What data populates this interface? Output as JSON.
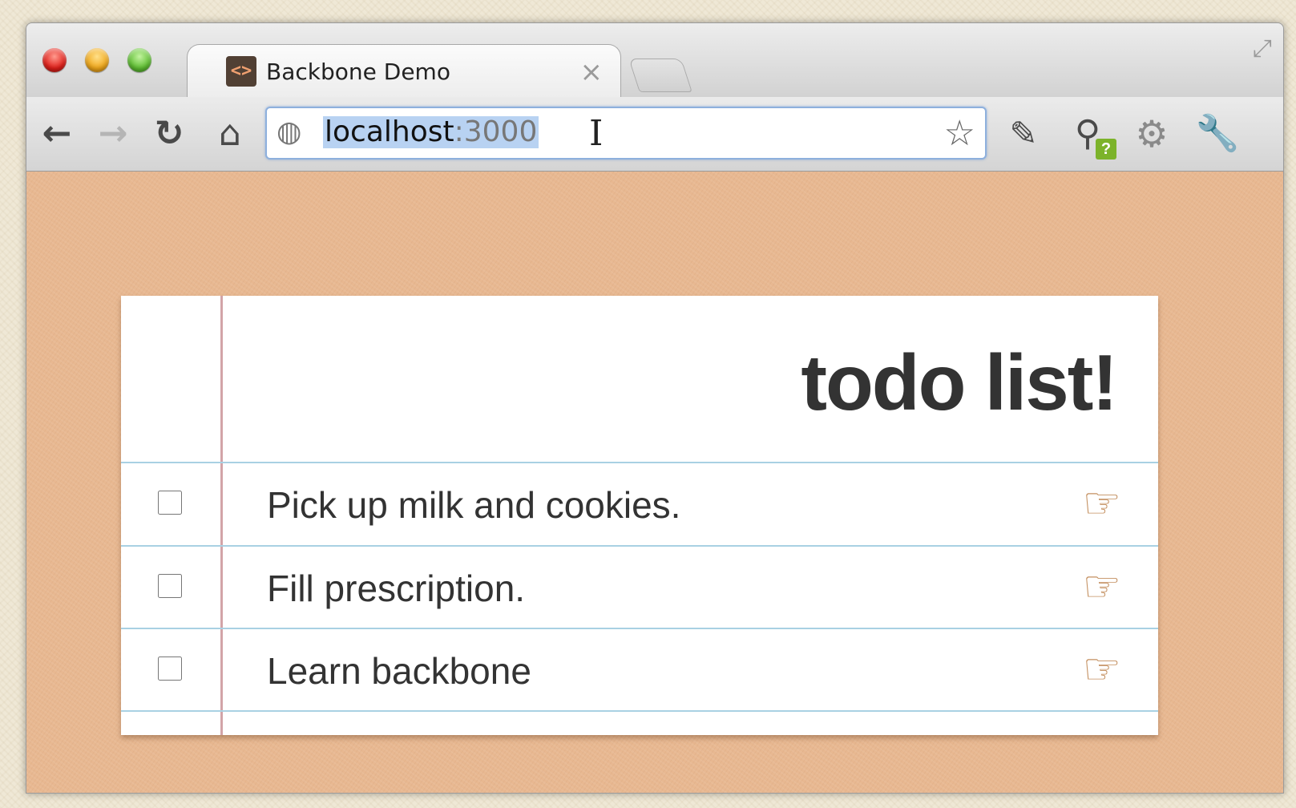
{
  "browser": {
    "tab": {
      "title": "Backbone Demo",
      "favicon": "<>",
      "close": "×"
    },
    "toolbar": {
      "back": "←",
      "forward": "→",
      "reload": "↻",
      "home": "⌂",
      "star": "☆",
      "ext1": "✎",
      "ext2": "⚲",
      "ext2_badge": "?",
      "settings": "⚙",
      "wrench": "🔧"
    },
    "address": {
      "host": "localhost",
      "port": ":3000",
      "globe": "◍"
    },
    "fullscreen": "⤢"
  },
  "app": {
    "title": "todo list!",
    "todos": [
      {
        "text": "Pick up milk and cookies.",
        "done": false,
        "hand": "☞"
      },
      {
        "text": "Fill prescription.",
        "done": false,
        "hand": "☞"
      },
      {
        "text": "Learn backbone",
        "done": false,
        "hand": "☞"
      }
    ]
  }
}
